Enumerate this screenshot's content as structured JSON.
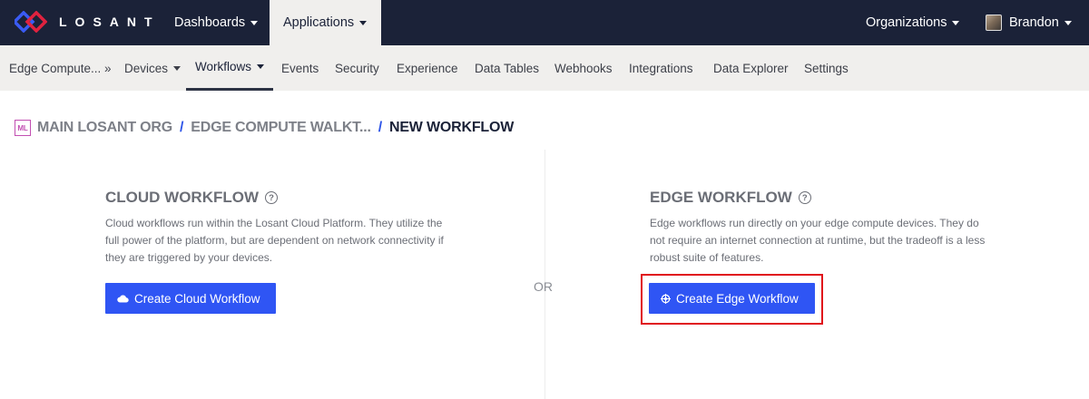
{
  "topnav": {
    "brand": "LOSANT",
    "dashboards": "Dashboards",
    "applications": "Applications",
    "organizations": "Organizations",
    "user": "Brandon"
  },
  "subnav": {
    "app": "Edge Compute... »",
    "devices": "Devices",
    "workflows": "Workflows",
    "events": "Events",
    "security": "Security",
    "experience": "Experience",
    "data_tables": "Data Tables",
    "webhooks": "Webhooks",
    "integrations": "Integrations",
    "data_explorer": "Data Explorer",
    "settings": "Settings"
  },
  "breadcrumb": {
    "badge": "ML",
    "org": "MAIN LOSANT ORG",
    "app": "EDGE COMPUTE WALKT...",
    "current": "NEW WORKFLOW",
    "separator": "/"
  },
  "or_label": "OR",
  "cloud": {
    "title": "CLOUD WORKFLOW",
    "description": "Cloud workflows run within the Losant Cloud Platform. They utilize the full power of the platform, but are dependent on network connectivity if they are triggered by your devices.",
    "button": "Create Cloud Workflow"
  },
  "edge": {
    "title": "EDGE WORKFLOW",
    "description": "Edge workflows run directly on your edge compute devices. They do not require an internet connection at runtime, but the tradeoff is a less robust suite of features.",
    "button": "Create Edge Workflow"
  },
  "colors": {
    "topnav_bg": "#1b2238",
    "subnav_bg": "#f0efed",
    "accent": "#2f55f4",
    "highlight": "#e0101b",
    "brand_red": "#e0223f",
    "brand_blue": "#3a5bf5"
  }
}
